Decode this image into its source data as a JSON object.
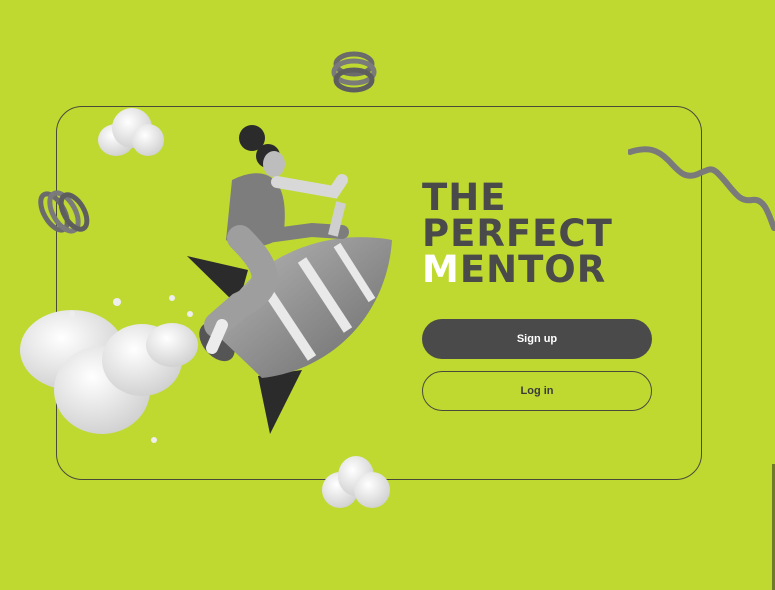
{
  "hero": {
    "title_line1": "THE",
    "title_line2": "PERFECT",
    "title_line3_accent": "M",
    "title_line3_rest": "ENTOR"
  },
  "actions": {
    "signup_label": "Sign up",
    "login_label": "Log in"
  },
  "colors": {
    "background": "#bfd931",
    "dark": "#4a4a4a",
    "accent_text": "#ffffff"
  },
  "icons": [
    "spring-icon",
    "cloud-icon",
    "squiggle-icon",
    "rocket-rider-illustration"
  ]
}
